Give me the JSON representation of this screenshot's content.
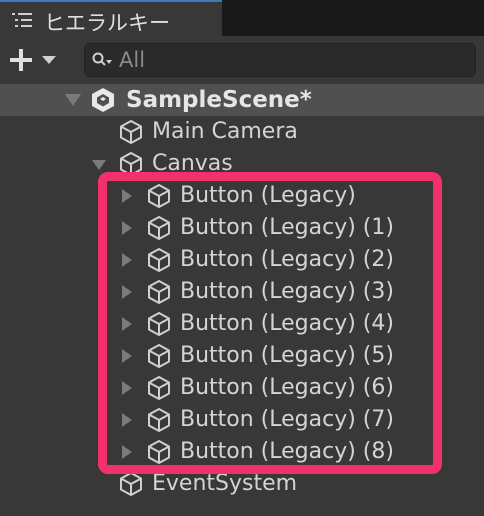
{
  "tab": {
    "title": "ヒエラルキー",
    "icon": "hierarchy-list-icon"
  },
  "toolbar": {
    "add_icon": "plus-dropdown-icon",
    "search_placeholder": "All",
    "search_icon": "search-filter-icon"
  },
  "scene": {
    "name": "SampleScene*",
    "icon": "unity-scene-icon",
    "expanded": true
  },
  "objects": {
    "main_camera": "Main Camera",
    "canvas": "Canvas",
    "buttons": [
      "Button (Legacy)",
      "Button (Legacy) (1)",
      "Button (Legacy) (2)",
      "Button (Legacy) (3)",
      "Button (Legacy) (4)",
      "Button (Legacy) (5)",
      "Button (Legacy) (6)",
      "Button (Legacy) (7)",
      "Button (Legacy) (8)"
    ],
    "event_system": "EventSystem"
  },
  "colors": {
    "highlight": "#f2316c",
    "tab_accent": "#3a79bb",
    "background": "#383838"
  }
}
